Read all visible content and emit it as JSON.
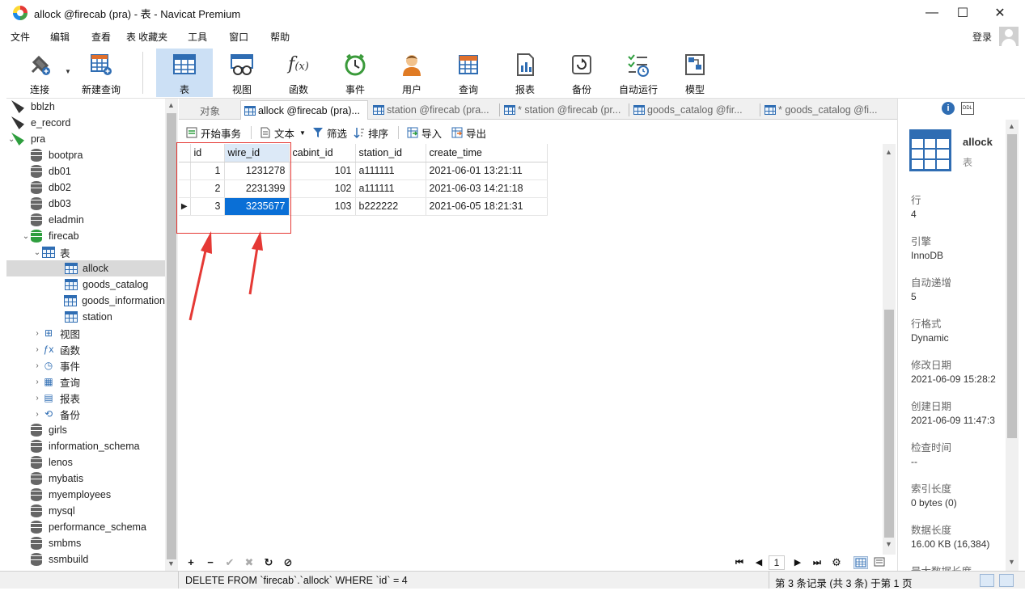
{
  "window": {
    "title": "allock @firecab (pra) - 表 - Navicat Premium",
    "minimize": "—",
    "maximize": "☐",
    "close": "✕"
  },
  "menu": [
    "文件",
    "编辑",
    "查看",
    "表",
    "收藏夹",
    "工具",
    "窗口",
    "帮助"
  ],
  "login": "登录",
  "toolbar": [
    {
      "label": "连接",
      "icon": "plug-icon"
    },
    {
      "label": "新建查询",
      "icon": "new-query-icon"
    },
    {
      "label": "表",
      "icon": "table-icon",
      "active": true
    },
    {
      "label": "视图",
      "icon": "view-icon"
    },
    {
      "label": "函数",
      "icon": "function-icon"
    },
    {
      "label": "事件",
      "icon": "clock-icon"
    },
    {
      "label": "用户",
      "icon": "user-icon"
    },
    {
      "label": "查询",
      "icon": "query-icon"
    },
    {
      "label": "报表",
      "icon": "report-icon"
    },
    {
      "label": "备份",
      "icon": "backup-icon"
    },
    {
      "label": "自动运行",
      "icon": "auto-run-icon"
    },
    {
      "label": "模型",
      "icon": "model-icon"
    }
  ],
  "tree": [
    {
      "label": "bblzh",
      "type": "conn"
    },
    {
      "label": "e_record",
      "type": "conn"
    },
    {
      "label": "pra",
      "type": "conn-open"
    },
    {
      "label": "bootpra",
      "type": "db"
    },
    {
      "label": "db01",
      "type": "db"
    },
    {
      "label": "db02",
      "type": "db"
    },
    {
      "label": "db03",
      "type": "db"
    },
    {
      "label": "eladmin",
      "type": "db"
    },
    {
      "label": "firecab",
      "type": "db-open"
    },
    {
      "label": "表",
      "type": "folder-table"
    },
    {
      "label": "allock",
      "type": "table",
      "selected": true
    },
    {
      "label": "goods_catalog",
      "type": "table"
    },
    {
      "label": "goods_information",
      "type": "table"
    },
    {
      "label": "station",
      "type": "table"
    },
    {
      "label": "视图",
      "type": "folder",
      "glyph": "⊞"
    },
    {
      "label": "函数",
      "type": "folder",
      "glyph": "ƒx"
    },
    {
      "label": "事件",
      "type": "folder",
      "glyph": "◷"
    },
    {
      "label": "查询",
      "type": "folder",
      "glyph": "▦"
    },
    {
      "label": "报表",
      "type": "folder",
      "glyph": "▤"
    },
    {
      "label": "备份",
      "type": "folder",
      "glyph": "⟲"
    },
    {
      "label": "girls",
      "type": "db"
    },
    {
      "label": "information_schema",
      "type": "db"
    },
    {
      "label": "lenos",
      "type": "db"
    },
    {
      "label": "mybatis",
      "type": "db"
    },
    {
      "label": "myemployees",
      "type": "db"
    },
    {
      "label": "mysql",
      "type": "db"
    },
    {
      "label": "performance_schema",
      "type": "db"
    },
    {
      "label": "smbms",
      "type": "db"
    },
    {
      "label": "ssmbuild",
      "type": "db"
    }
  ],
  "tabs": [
    {
      "label": "对象"
    },
    {
      "label": "allock @firecab (pra)..."
    },
    {
      "label": "station @firecab (pra..."
    },
    {
      "label": "* station @firecab (pr..."
    },
    {
      "label": "goods_catalog @fir..."
    },
    {
      "label": "* goods_catalog @fi..."
    }
  ],
  "subtoolbar": {
    "begin": "开始事务",
    "text": "文本",
    "filter": "筛选",
    "sort": "排序",
    "import": "导入",
    "export": "导出"
  },
  "grid": {
    "columns": [
      "id",
      "wire_id",
      "cabint_id",
      "station_id",
      "create_time"
    ],
    "rows": [
      [
        "1",
        "1231278",
        "101",
        "a111111",
        "2021-06-01 13:21:11"
      ],
      [
        "2",
        "2231399",
        "102",
        "a111111",
        "2021-06-03 14:21:18"
      ],
      [
        "3",
        "3235677",
        "103",
        "b222222",
        "2021-06-05 18:21:31"
      ]
    ],
    "current_row_marker": "▶"
  },
  "gridbar": {
    "add": "+",
    "remove": "−",
    "apply": "✔",
    "discard": "✖",
    "refresh": "↻",
    "stop": "⊘",
    "first": "⏮",
    "prev": "◀",
    "page": "1",
    "next": "▶",
    "last": "⏭",
    "settings": "⚙"
  },
  "info": {
    "name": "allock",
    "type": "表",
    "fields": [
      {
        "label": "行",
        "value": "4"
      },
      {
        "label": "引擎",
        "value": "InnoDB"
      },
      {
        "label": "自动递增",
        "value": "5"
      },
      {
        "label": "行格式",
        "value": "Dynamic"
      },
      {
        "label": "修改日期",
        "value": "2021-06-09 15:28:2"
      },
      {
        "label": "创建日期",
        "value": "2021-06-09 11:47:3"
      },
      {
        "label": "检查时间",
        "value": "--"
      },
      {
        "label": "索引长度",
        "value": "0 bytes (0)"
      },
      {
        "label": "数据长度",
        "value": "16.00 KB (16,384)"
      },
      {
        "label": "最大数据长度",
        "value": ""
      }
    ]
  },
  "status": {
    "sql": "DELETE FROM `firecab`.`allock` WHERE `id` = 4",
    "records": "第 3 条记录 (共 3 条) 于第 1 页"
  },
  "colors": {
    "accent": "#2f6db3",
    "selection": "#0a6fd6",
    "annotation": "#e53935"
  }
}
